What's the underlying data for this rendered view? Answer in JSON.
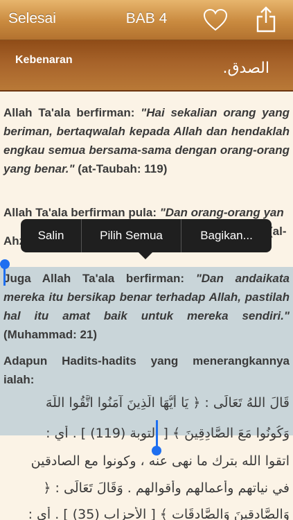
{
  "navbar": {
    "done_label": "Selesai",
    "title": "BAB 4",
    "favorite_icon": "heart-outline-icon",
    "share_icon": "share-icon"
  },
  "chapter": {
    "title_latin": "Kebenaran",
    "title_arabic": "الصدق."
  },
  "edit_menu": {
    "copy": "Salin",
    "select_all": "Pilih Semua",
    "share": "Bagikan..."
  },
  "content": {
    "p1": {
      "lead": "Allah Ta'ala berfirman: ",
      "quote": "\"Hai sekalian orang yang beriman, bertaqwalah kepada Allah dan hendaklah engkau semua bersama-sama dengan orang-orang yang benar.\"",
      "ref": " (at-Taubah: 119)"
    },
    "p2": {
      "lead": "Allah Ta'ala berfirman pula: ",
      "quote": "\"Dan orang-orang yan",
      "ref_tail": "(al-",
      "ref_tail2": "Ahzab: 35)"
    },
    "p3": {
      "lead": "Juga Allah Ta'ala berfirman: ",
      "quote": "\"Dan andaikata mereka itu bersikap benar terhadap Allah, pastilah hal itu amat baik untuk mereka sendiri.\"",
      "ref": " (Muhammad: 21)"
    },
    "p4": "Adapun Hadits-hadits yang menerangkannya ialah:",
    "arabic_lines": [
      "قَالَ اللهُ تَعَالَى : ﴿ يَا أَيُّهَا الَّذِينَ آمَنُوا اتَّقُوا اللَّهَ",
      "وَكُونُوا مَعَ الصَّادِقِينَ ﴾ [ التوبة (119) ] . أي :",
      "اتقوا الله بترك ما نهى عنه ، وكونوا مع الصادقين",
      "في نياتهم وأعمالهم وأقوالهم . وَقَالَ تَعَالَى : ﴿",
      "وَالصَّادِقِينَ وَالصَّادِقَاتِ ﴾ [ الأحزاب (35) ] . أي :"
    ]
  }
}
